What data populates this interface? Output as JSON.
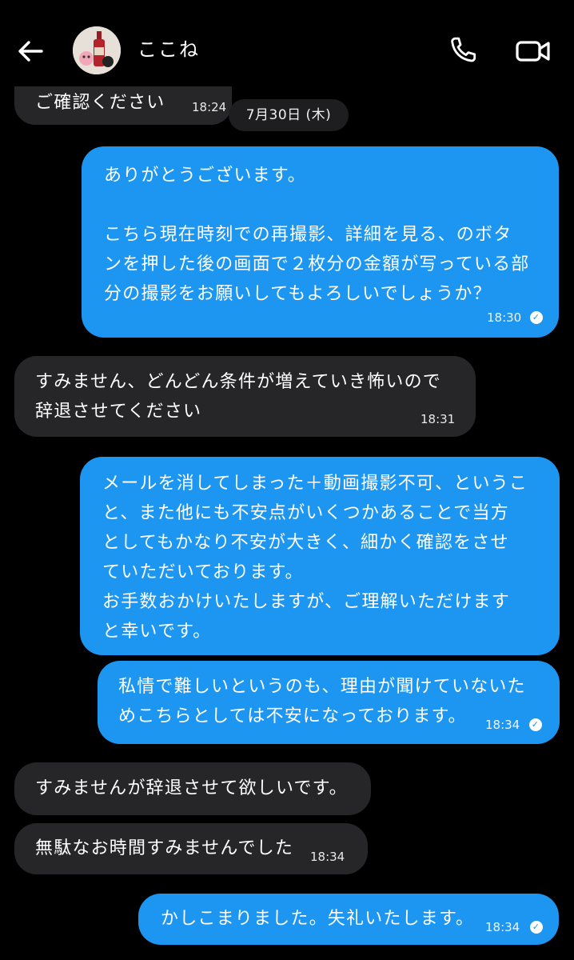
{
  "header": {
    "contact_name": "ここね",
    "icons": {
      "back": "back-arrow-icon",
      "call": "phone-icon",
      "video": "video-camera-icon"
    }
  },
  "date_divider": "7月30日 (木)",
  "messages": [
    {
      "dir": "in",
      "text": "ご確認ください",
      "time": "18:24"
    },
    {
      "dir": "out",
      "text": "ありがとうございます。\n\nこちら現在時刻での再撮影、詳細を見る、のボタ\nンを押した後の画面で２枚分の金額が写っている部\n分の撮影をお願いしてもよろしいでしょうか？",
      "time": "18:30",
      "read": true
    },
    {
      "dir": "in",
      "text": "すみません、どんどん条件が増えていき怖いので\n辞退させてください",
      "time": "18:31"
    },
    {
      "dir": "out",
      "text": "メールを消してしまった＋動画撮影不可、というこ\nと、また他にも不安点がいくつかあることで当方\nとしてもかなり不安が大きく、細かく確認をさせ\nていただいております。\nお手数おかけいたしますが、ご理解いただけます\nと幸いです。"
    },
    {
      "dir": "out",
      "text": "私情で難しいというのも、理由が聞けていないた\nめこちらとしては不安になっております。",
      "time": "18:34",
      "read": true
    },
    {
      "dir": "in",
      "text": "すみませんが辞退させて欲しいです。"
    },
    {
      "dir": "in",
      "text": "無駄なお時間すみませんでした",
      "time": "18:34"
    },
    {
      "dir": "out",
      "text": "かしこまりました。失礼いたします。",
      "time": "18:34",
      "read": true
    }
  ],
  "colors": {
    "background": "#000000",
    "incoming_bubble": "#262628",
    "outgoing_bubble": "#1c96f0",
    "text": "#ffffff"
  }
}
